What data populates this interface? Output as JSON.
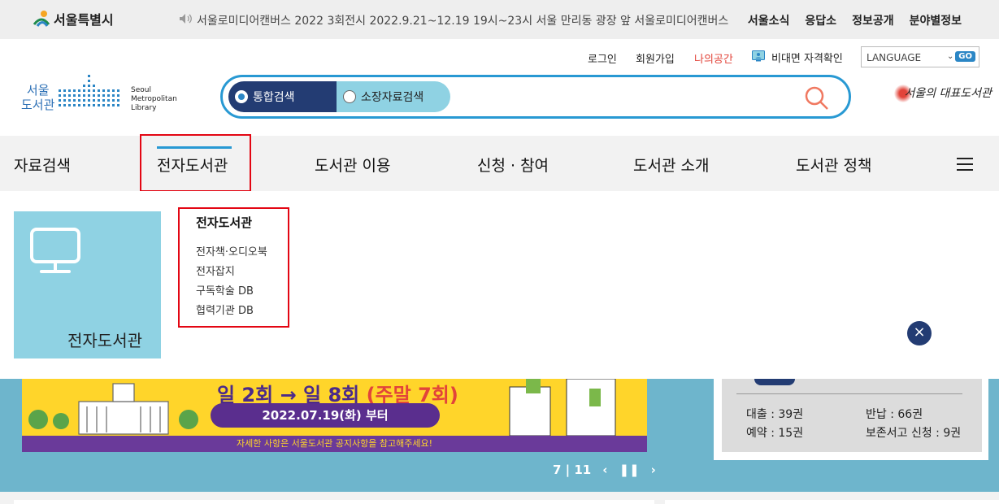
{
  "topbar": {
    "city_logo_text": "서울특별시",
    "notice": "서울로미디어캔버스 2022 3회전시 2022.9.21~12.19 19시~23시 서울 만리동 광장 앞 서울로미디어캔버스",
    "links": [
      "서울소식",
      "응답소",
      "정보공개",
      "분야별정보"
    ]
  },
  "util": {
    "login": "로그인",
    "join": "회원가입",
    "my_space": "나의공간",
    "verify": "비대면 자격확인",
    "language": "LANGUAGE",
    "go": "GO"
  },
  "library_logo": {
    "ko_line1": "서울",
    "ko_line2": "도서관",
    "en_line1": "Seoul",
    "en_line2": "Metropolitan",
    "en_line3": "Library"
  },
  "search": {
    "tab_integrated": "통합검색",
    "tab_holdings": "소장자료검색"
  },
  "slogan": "서울의 대표도서관",
  "gnb": {
    "items": [
      "자료검색",
      "전자도서관",
      "도서관 이용",
      "신청 · 참여",
      "도서관 소개",
      "도서관 정책"
    ]
  },
  "dropdown": {
    "card_title": "전자도서관",
    "section_title": "전자도서관",
    "links": [
      "전자책·오디오북",
      "전자잡지",
      "구독학술 DB",
      "협력기관 DB"
    ]
  },
  "banner": {
    "headline_prefix": "일 2회 → 일 8회",
    "headline_suffix": "(주말 7회)",
    "date": "2022.07.19(화) 부터",
    "footer": "자세한 사항은 서울도서관 공지사항을 참고해주세요!"
  },
  "pager": {
    "current": "7",
    "total": "11"
  },
  "my_library": {
    "loan": "대출 : 39권",
    "return": "반납 : 66권",
    "reserve": "예약 : 15권",
    "preservation": "보존서고 신청 : 9권"
  },
  "colors": {
    "navy": "#233c73",
    "sky": "#2899d3",
    "light_teal": "#8fd2e3",
    "highlight_red": "#e30613",
    "accent_red": "#e2443a"
  }
}
